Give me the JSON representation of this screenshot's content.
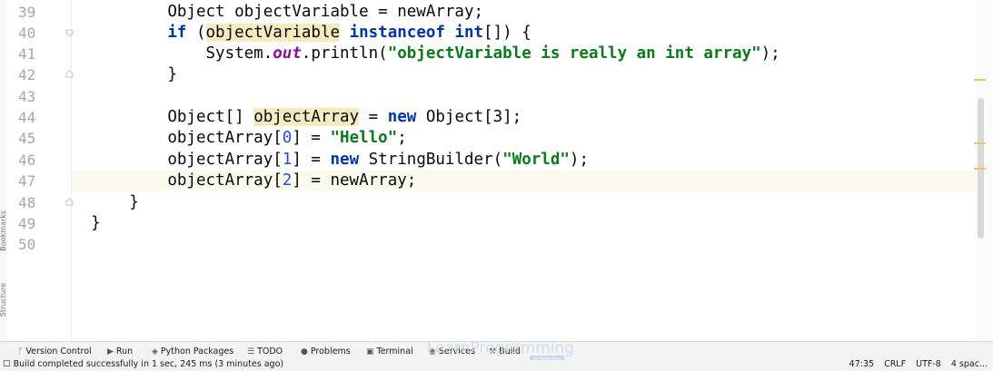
{
  "editor": {
    "line_numbers": [
      "39",
      "40",
      "41",
      "42",
      "43",
      "44",
      "45",
      "46",
      "47",
      "48",
      "49",
      "50"
    ]
  },
  "sidebar": {
    "bookmarks_label": "Bookmarks",
    "structure_label": "Structure"
  },
  "tool_windows": {
    "version_control": "Version Control",
    "run": "Run",
    "python_packages": "Python Packages",
    "todo": "TODO",
    "problems": "Problems",
    "terminal": "Terminal",
    "services": "Services",
    "build": "Build"
  },
  "status": {
    "message": "Build completed successfully in 1 sec, 245 ms (3 minutes ago)",
    "position": "47:35",
    "line_separator": "CRLF",
    "encoding": "UTF-8",
    "indent": "4 spac..."
  },
  "watermark": {
    "text": "LearnProgramming",
    "sub": "academy"
  },
  "colors": {
    "keyword": "#0033b3",
    "string": "#067d17",
    "number": "#1750eb",
    "static_field": "#871094",
    "identifier_highlight": "#f6ebbc",
    "current_line": "#fcfaed"
  }
}
